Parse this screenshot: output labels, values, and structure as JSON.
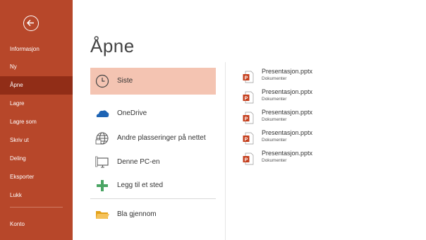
{
  "sidebar": {
    "items": [
      {
        "label": "Informasjon"
      },
      {
        "label": "Ny"
      },
      {
        "label": "Åpne"
      },
      {
        "label": "Lagre"
      },
      {
        "label": "Lagre som"
      },
      {
        "label": "Skriv ut"
      },
      {
        "label": "Deling"
      },
      {
        "label": "Eksporter"
      },
      {
        "label": "Lukk"
      },
      {
        "label": "Konto"
      }
    ],
    "active_item": "Åpne",
    "colors": {
      "background": "#b7472a",
      "active": "#912d17"
    }
  },
  "page": {
    "title": "Åpne"
  },
  "locations": [
    {
      "label": "Siste",
      "icon": "clock-icon",
      "selected": true
    },
    {
      "label": "OneDrive",
      "icon": "cloud-icon"
    },
    {
      "label": "Andre plasseringer på nettet",
      "icon": "globe-icon"
    },
    {
      "label": "Denne PC-en",
      "icon": "computer-icon"
    },
    {
      "label": "Legg til et sted",
      "icon": "plus-icon"
    },
    {
      "label": "Bla gjennom",
      "icon": "folder-icon"
    }
  ],
  "recent_files": [
    {
      "name": "Presentasjon.pptx",
      "path": "Dokumenter",
      "icon": "powerpoint-file-icon"
    },
    {
      "name": "Presentasjon.pptx",
      "path": "Dokumenter",
      "icon": "powerpoint-file-icon"
    },
    {
      "name": "Presentasjon.pptx",
      "path": "Dokumenter",
      "icon": "powerpoint-file-icon"
    },
    {
      "name": "Presentasjon.pptx",
      "path": "Dokumenter",
      "icon": "powerpoint-file-icon"
    },
    {
      "name": "Presentasjon.pptx",
      "path": "Dokumenter",
      "icon": "powerpoint-file-icon"
    }
  ]
}
